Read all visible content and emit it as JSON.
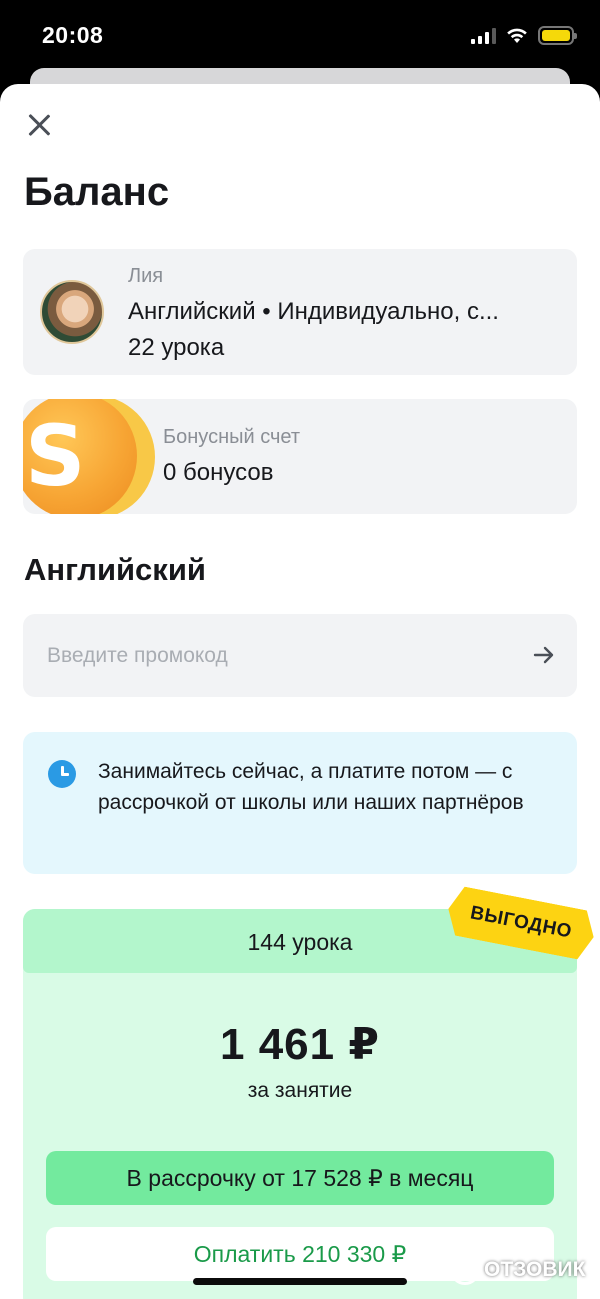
{
  "status_bar": {
    "time": "20:08"
  },
  "page": {
    "title": "Баланс"
  },
  "student": {
    "name": "Лия",
    "course": "Английский • Индивидуально, с...",
    "lessons": "22 урока"
  },
  "bonus": {
    "coin_letter": "S",
    "label": "Бонусный счет",
    "value": "0 бонусов"
  },
  "section": {
    "title": "Английский"
  },
  "promo": {
    "placeholder": "Введите промокод"
  },
  "info": {
    "text": "Занимайтесь сейчас, а платите потом — с рассрочкой от школы или наших партнёров"
  },
  "tariff": {
    "lessons": "144 урока",
    "badge": "ВЫГОДНО",
    "price": "1 461 ₽",
    "price_unit": "за занятие",
    "installment_button": "В рассрочку от 17 528 ₽ в месяц",
    "pay_button": "Оплатить 210 330 ₽"
  },
  "watermark": {
    "text": "ОТЗОВИК"
  },
  "colors": {
    "accent_green": "#73ea9e",
    "pay_text_green": "#1a9a49",
    "badge_yellow": "#fdd312",
    "info_blue": "#2a9ae4"
  }
}
